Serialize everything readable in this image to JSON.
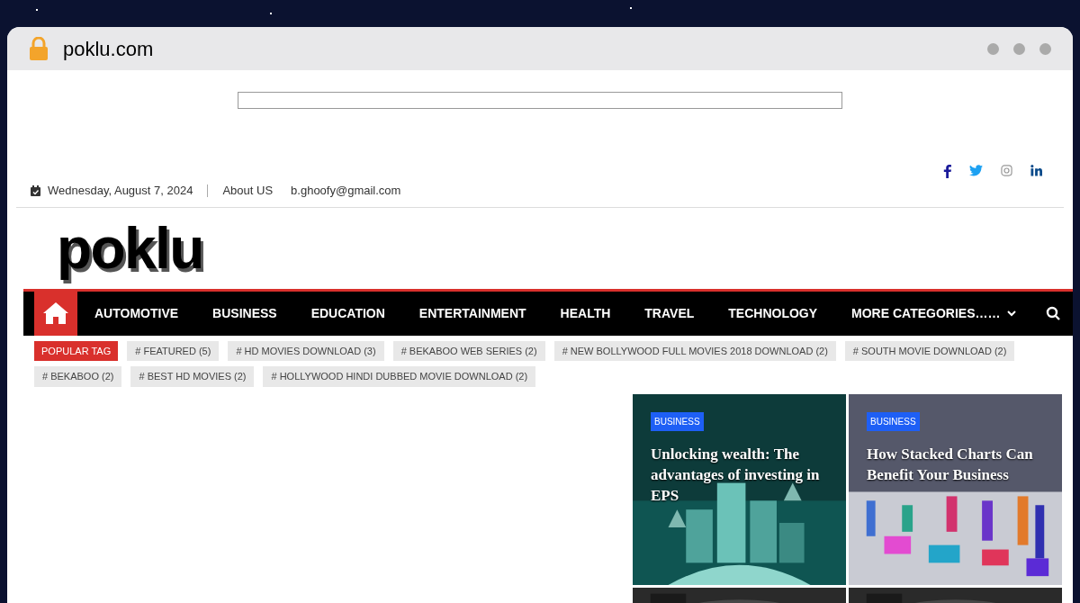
{
  "browser": {
    "address": "poklu.com"
  },
  "top_bar": {
    "date": "Wednesday, August 7, 2024",
    "links": [
      "About US",
      "b.ghoofy@gmail.com"
    ]
  },
  "logo": "poklu",
  "nav": {
    "items": [
      "AUTOMOTIVE",
      "BUSINESS",
      "EDUCATION",
      "ENTERTAINMENT",
      "HEALTH",
      "TRAVEL",
      "TECHNOLOGY"
    ],
    "more": "MORE CATEGORIES……"
  },
  "tags": {
    "heading": "POPULAR TAG",
    "items": [
      "# FEATURED (5)",
      "# HD MOVIES DOWNLOAD (3)",
      "# BEKABOO WEB SERIES (2)",
      "# NEW BOLLYWOOD FULL MOVIES 2018 DOWNLOAD (2)",
      "# SOUTH MOVIE DOWNLOAD (2)",
      "# BEKABOO (2)",
      "# BEST HD MOVIES (2)",
      "# HOLLYWOOD HINDI DUBBED MOVIE DOWNLOAD (2)"
    ]
  },
  "cards": [
    {
      "category": "BUSINESS",
      "title": "Unlocking wealth: The advantages of investing in EPS"
    },
    {
      "category": "BUSINESS",
      "title": "How Stacked Charts Can Benefit Your Business"
    }
  ]
}
